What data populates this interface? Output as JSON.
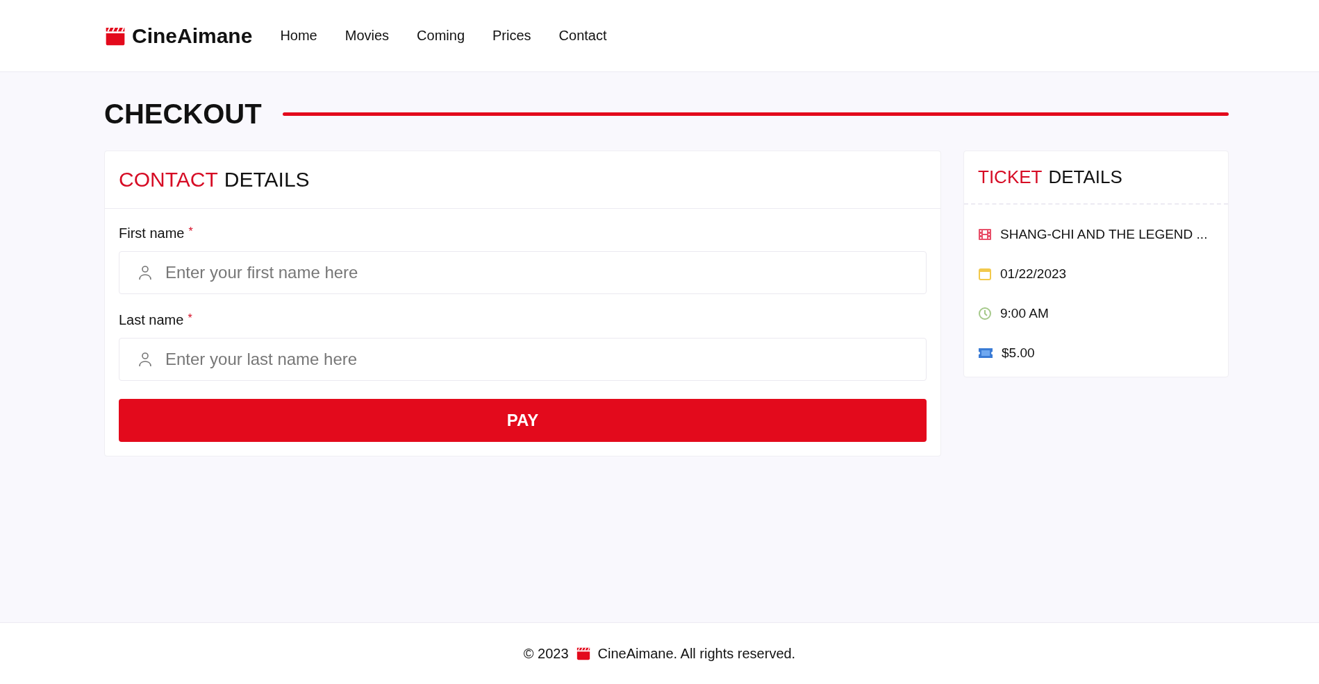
{
  "header": {
    "brand": "CineAimane",
    "nav": [
      {
        "label": "Home"
      },
      {
        "label": "Movies"
      },
      {
        "label": "Coming"
      },
      {
        "label": "Prices"
      },
      {
        "label": "Contact"
      }
    ]
  },
  "page_title": "CHECKOUT",
  "contact_card": {
    "title_accent": "CONTACT",
    "title_rest": "DETAILS",
    "fields": [
      {
        "label": "First name",
        "required_mark": "*",
        "placeholder": "Enter your first name here"
      },
      {
        "label": "Last name",
        "required_mark": "*",
        "placeholder": "Enter your last name here"
      }
    ],
    "submit": "PAY"
  },
  "ticket_card": {
    "title_accent": "TICKET",
    "title_rest": "DETAILS",
    "items": [
      {
        "kind": "movie",
        "text": "SHANG-CHI AND THE LEGEND ..."
      },
      {
        "kind": "date",
        "text": "01/22/2023"
      },
      {
        "kind": "time",
        "text": "9:00 AM"
      },
      {
        "kind": "price",
        "text": "$5.00"
      }
    ]
  },
  "footer": {
    "copyright": "© 2023",
    "text": "CineAimane. All rights reserved."
  }
}
